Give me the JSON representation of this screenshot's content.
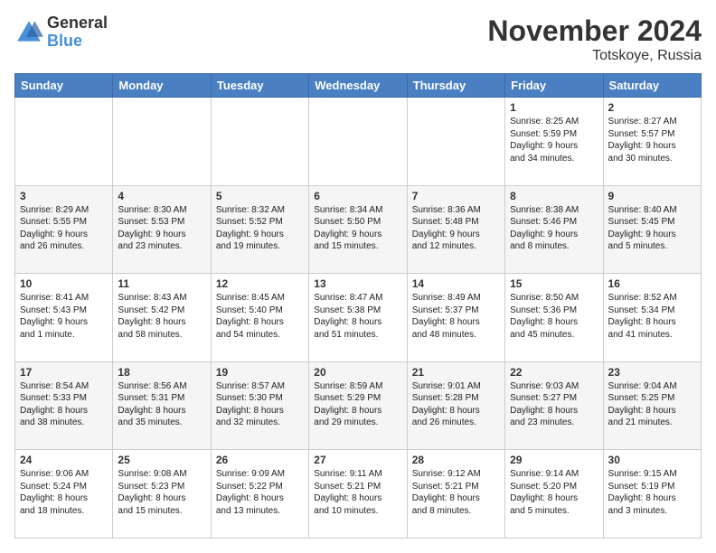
{
  "logo": {
    "general": "General",
    "blue": "Blue"
  },
  "title": "November 2024",
  "location": "Totskoye, Russia",
  "days_of_week": [
    "Sunday",
    "Monday",
    "Tuesday",
    "Wednesday",
    "Thursday",
    "Friday",
    "Saturday"
  ],
  "weeks": [
    [
      {
        "day": "",
        "info": ""
      },
      {
        "day": "",
        "info": ""
      },
      {
        "day": "",
        "info": ""
      },
      {
        "day": "",
        "info": ""
      },
      {
        "day": "",
        "info": ""
      },
      {
        "day": "1",
        "info": "Sunrise: 8:25 AM\nSunset: 5:59 PM\nDaylight: 9 hours\nand 34 minutes."
      },
      {
        "day": "2",
        "info": "Sunrise: 8:27 AM\nSunset: 5:57 PM\nDaylight: 9 hours\nand 30 minutes."
      }
    ],
    [
      {
        "day": "3",
        "info": "Sunrise: 8:29 AM\nSunset: 5:55 PM\nDaylight: 9 hours\nand 26 minutes."
      },
      {
        "day": "4",
        "info": "Sunrise: 8:30 AM\nSunset: 5:53 PM\nDaylight: 9 hours\nand 23 minutes."
      },
      {
        "day": "5",
        "info": "Sunrise: 8:32 AM\nSunset: 5:52 PM\nDaylight: 9 hours\nand 19 minutes."
      },
      {
        "day": "6",
        "info": "Sunrise: 8:34 AM\nSunset: 5:50 PM\nDaylight: 9 hours\nand 15 minutes."
      },
      {
        "day": "7",
        "info": "Sunrise: 8:36 AM\nSunset: 5:48 PM\nDaylight: 9 hours\nand 12 minutes."
      },
      {
        "day": "8",
        "info": "Sunrise: 8:38 AM\nSunset: 5:46 PM\nDaylight: 9 hours\nand 8 minutes."
      },
      {
        "day": "9",
        "info": "Sunrise: 8:40 AM\nSunset: 5:45 PM\nDaylight: 9 hours\nand 5 minutes."
      }
    ],
    [
      {
        "day": "10",
        "info": "Sunrise: 8:41 AM\nSunset: 5:43 PM\nDaylight: 9 hours\nand 1 minute."
      },
      {
        "day": "11",
        "info": "Sunrise: 8:43 AM\nSunset: 5:42 PM\nDaylight: 8 hours\nand 58 minutes."
      },
      {
        "day": "12",
        "info": "Sunrise: 8:45 AM\nSunset: 5:40 PM\nDaylight: 8 hours\nand 54 minutes."
      },
      {
        "day": "13",
        "info": "Sunrise: 8:47 AM\nSunset: 5:38 PM\nDaylight: 8 hours\nand 51 minutes."
      },
      {
        "day": "14",
        "info": "Sunrise: 8:49 AM\nSunset: 5:37 PM\nDaylight: 8 hours\nand 48 minutes."
      },
      {
        "day": "15",
        "info": "Sunrise: 8:50 AM\nSunset: 5:36 PM\nDaylight: 8 hours\nand 45 minutes."
      },
      {
        "day": "16",
        "info": "Sunrise: 8:52 AM\nSunset: 5:34 PM\nDaylight: 8 hours\nand 41 minutes."
      }
    ],
    [
      {
        "day": "17",
        "info": "Sunrise: 8:54 AM\nSunset: 5:33 PM\nDaylight: 8 hours\nand 38 minutes."
      },
      {
        "day": "18",
        "info": "Sunrise: 8:56 AM\nSunset: 5:31 PM\nDaylight: 8 hours\nand 35 minutes."
      },
      {
        "day": "19",
        "info": "Sunrise: 8:57 AM\nSunset: 5:30 PM\nDaylight: 8 hours\nand 32 minutes."
      },
      {
        "day": "20",
        "info": "Sunrise: 8:59 AM\nSunset: 5:29 PM\nDaylight: 8 hours\nand 29 minutes."
      },
      {
        "day": "21",
        "info": "Sunrise: 9:01 AM\nSunset: 5:28 PM\nDaylight: 8 hours\nand 26 minutes."
      },
      {
        "day": "22",
        "info": "Sunrise: 9:03 AM\nSunset: 5:27 PM\nDaylight: 8 hours\nand 23 minutes."
      },
      {
        "day": "23",
        "info": "Sunrise: 9:04 AM\nSunset: 5:25 PM\nDaylight: 8 hours\nand 21 minutes."
      }
    ],
    [
      {
        "day": "24",
        "info": "Sunrise: 9:06 AM\nSunset: 5:24 PM\nDaylight: 8 hours\nand 18 minutes."
      },
      {
        "day": "25",
        "info": "Sunrise: 9:08 AM\nSunset: 5:23 PM\nDaylight: 8 hours\nand 15 minutes."
      },
      {
        "day": "26",
        "info": "Sunrise: 9:09 AM\nSunset: 5:22 PM\nDaylight: 8 hours\nand 13 minutes."
      },
      {
        "day": "27",
        "info": "Sunrise: 9:11 AM\nSunset: 5:21 PM\nDaylight: 8 hours\nand 10 minutes."
      },
      {
        "day": "28",
        "info": "Sunrise: 9:12 AM\nSunset: 5:21 PM\nDaylight: 8 hours\nand 8 minutes."
      },
      {
        "day": "29",
        "info": "Sunrise: 9:14 AM\nSunset: 5:20 PM\nDaylight: 8 hours\nand 5 minutes."
      },
      {
        "day": "30",
        "info": "Sunrise: 9:15 AM\nSunset: 5:19 PM\nDaylight: 8 hours\nand 3 minutes."
      }
    ]
  ]
}
